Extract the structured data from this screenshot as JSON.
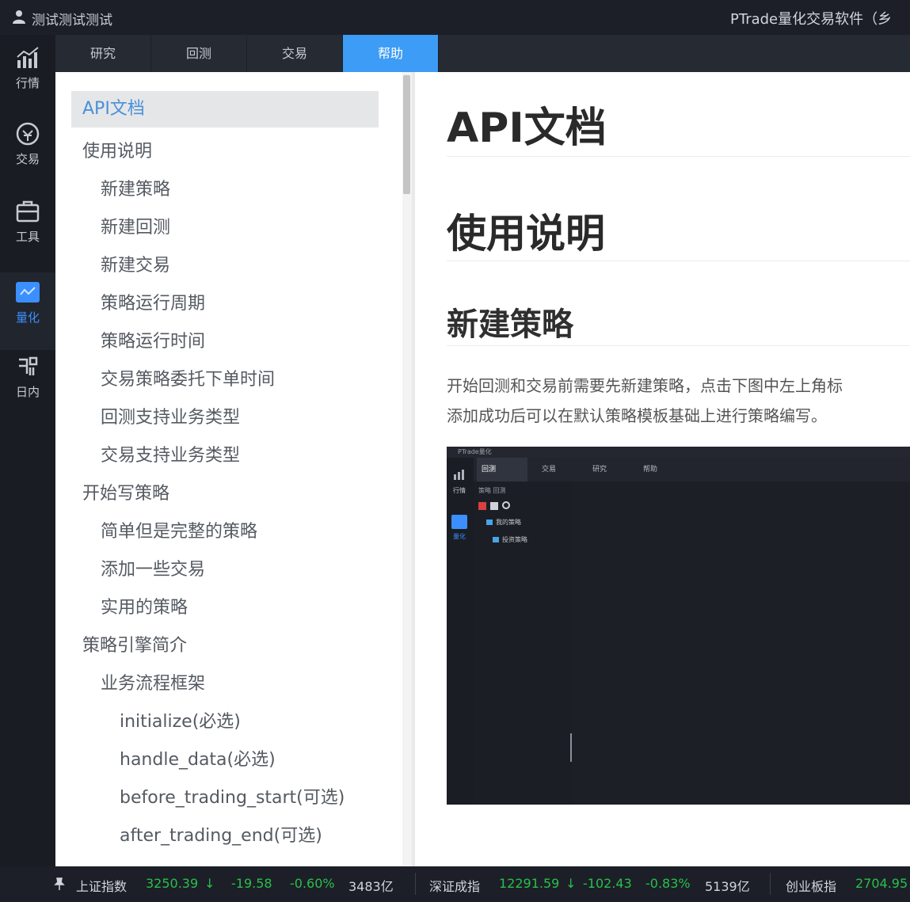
{
  "titlebar": {
    "username": "测试测试测试",
    "app_title": "PTrade量化交易软件（乡"
  },
  "sidenav": {
    "items": [
      {
        "label": "行情",
        "icon": "chart-icon"
      },
      {
        "label": "交易",
        "icon": "trade-icon"
      },
      {
        "label": "工具",
        "icon": "toolbox-icon"
      },
      {
        "label": "量化",
        "icon": "quant-icon"
      },
      {
        "label": "日内",
        "icon": "intraday-icon"
      }
    ]
  },
  "tabs": [
    {
      "label": "研究"
    },
    {
      "label": "回测"
    },
    {
      "label": "交易"
    },
    {
      "label": "帮助"
    }
  ],
  "toc": {
    "items": [
      {
        "label": "API文档",
        "level": 0
      },
      {
        "label": "使用说明",
        "level": 0
      },
      {
        "label": "新建策略",
        "level": 1
      },
      {
        "label": "新建回测",
        "level": 1
      },
      {
        "label": "新建交易",
        "level": 1
      },
      {
        "label": "策略运行周期",
        "level": 1
      },
      {
        "label": "策略运行时间",
        "level": 1
      },
      {
        "label": "交易策略委托下单时间",
        "level": 1
      },
      {
        "label": "回测支持业务类型",
        "level": 1
      },
      {
        "label": "交易支持业务类型",
        "level": 1
      },
      {
        "label": "开始写策略",
        "level": 0
      },
      {
        "label": "简单但是完整的策略",
        "level": 1
      },
      {
        "label": "添加一些交易",
        "level": 1
      },
      {
        "label": "实用的策略",
        "level": 1
      },
      {
        "label": "策略引擎简介",
        "level": 0
      },
      {
        "label": "业务流程框架",
        "level": 1
      },
      {
        "label": "initialize(必选)",
        "level": 2
      },
      {
        "label": "handle_data(必选)",
        "level": 2
      },
      {
        "label": "before_trading_start(可选)",
        "level": 2
      },
      {
        "label": "after_trading_end(可选)",
        "level": 2
      }
    ]
  },
  "content": {
    "h1": "API文档",
    "h1b": "使用说明",
    "h2": "新建策略",
    "para_line1": "开始回测和交易前需要先新建策略，点击下图中左上角标",
    "para_line2": "添加成功后可以在默认策略模板基础上进行策略编写。",
    "screenshot": {
      "title": "PTrade量化",
      "tabs": [
        "回测",
        "交易",
        "研究",
        "帮助"
      ],
      "nav_label": "行情",
      "sub_tabs": "策略  回测",
      "tree_items": [
        "我的策略",
        "投资策略"
      ],
      "side_label": "量化"
    }
  },
  "statusbar": {
    "indices": [
      {
        "name": "上证指数",
        "price": "3250.39",
        "change": "-19.58",
        "pct": "-0.60%",
        "vol": "3483亿"
      },
      {
        "name": "深证成指",
        "price": "12291.59",
        "change": "-102.43",
        "pct": "-0.83%",
        "vol": "5139亿"
      },
      {
        "name": "创业板指",
        "price": "2704.95",
        "change": "",
        "pct": "",
        "vol": ""
      }
    ]
  },
  "colors": {
    "accent": "#3d9cf5",
    "down_green": "#28c04a",
    "toc_active": "#4a90d9"
  }
}
